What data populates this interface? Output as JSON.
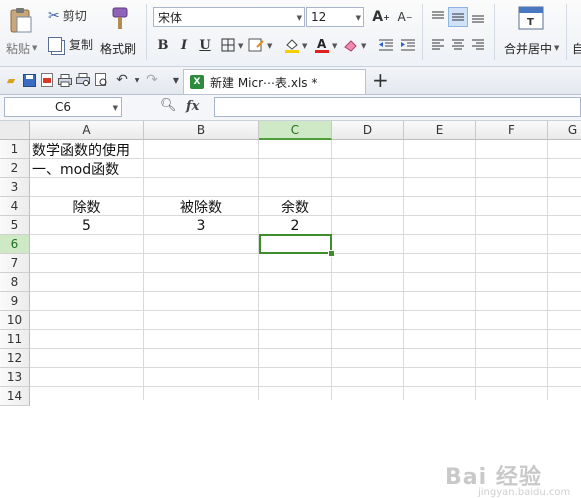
{
  "ribbon": {
    "paste_label": "粘贴",
    "cut_label": "剪切",
    "copy_label": "复制",
    "format_painter_label": "格式刷",
    "font_name": "宋体",
    "font_size": "12",
    "bold": "B",
    "italic": "I",
    "underline": "U",
    "merge_center_label": "合并居中",
    "auto_wrap_label": "自"
  },
  "tabbar": {
    "doc_tab_label": "新建 Micr⋯表.xls *",
    "new_tab": "+"
  },
  "formula_bar": {
    "name_box": "C6",
    "fx_label": "fx",
    "value": ""
  },
  "sheet": {
    "columns": [
      "A",
      "B",
      "C",
      "D",
      "E",
      "F",
      "G"
    ],
    "active_column": "C",
    "rows": [
      "1",
      "2",
      "3",
      "4",
      "5",
      "6",
      "7",
      "8",
      "9",
      "10",
      "11",
      "12",
      "13",
      "14"
    ],
    "active_row": "6",
    "cells": {
      "A1": "数学函数的使用",
      "A2": "一、mod函数",
      "A4": "除数",
      "B4": "被除数",
      "C4": "余数",
      "A5": "5",
      "B5": "3",
      "C5": "2"
    }
  },
  "watermark": {
    "text": "Bai 经验",
    "sub": "jingyan.baidu.com"
  },
  "colors": {
    "selection": "#3e8f2c",
    "active_header": "#cfe9c6",
    "grid": "#d9d9d9"
  }
}
